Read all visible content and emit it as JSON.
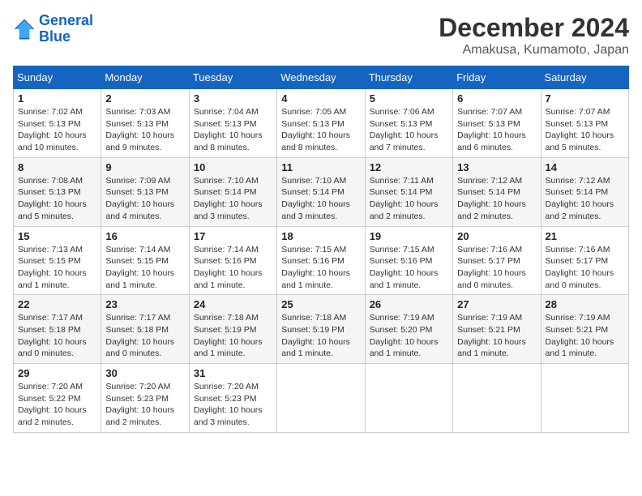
{
  "header": {
    "logo_line1": "General",
    "logo_line2": "Blue",
    "month": "December 2024",
    "location": "Amakusa, Kumamoto, Japan"
  },
  "weekdays": [
    "Sunday",
    "Monday",
    "Tuesday",
    "Wednesday",
    "Thursday",
    "Friday",
    "Saturday"
  ],
  "weeks": [
    [
      {
        "day": "1",
        "info": "Sunrise: 7:02 AM\nSunset: 5:13 PM\nDaylight: 10 hours\nand 10 minutes."
      },
      {
        "day": "2",
        "info": "Sunrise: 7:03 AM\nSunset: 5:13 PM\nDaylight: 10 hours\nand 9 minutes."
      },
      {
        "day": "3",
        "info": "Sunrise: 7:04 AM\nSunset: 5:13 PM\nDaylight: 10 hours\nand 8 minutes."
      },
      {
        "day": "4",
        "info": "Sunrise: 7:05 AM\nSunset: 5:13 PM\nDaylight: 10 hours\nand 8 minutes."
      },
      {
        "day": "5",
        "info": "Sunrise: 7:06 AM\nSunset: 5:13 PM\nDaylight: 10 hours\nand 7 minutes."
      },
      {
        "day": "6",
        "info": "Sunrise: 7:07 AM\nSunset: 5:13 PM\nDaylight: 10 hours\nand 6 minutes."
      },
      {
        "day": "7",
        "info": "Sunrise: 7:07 AM\nSunset: 5:13 PM\nDaylight: 10 hours\nand 5 minutes."
      }
    ],
    [
      {
        "day": "8",
        "info": "Sunrise: 7:08 AM\nSunset: 5:13 PM\nDaylight: 10 hours\nand 5 minutes."
      },
      {
        "day": "9",
        "info": "Sunrise: 7:09 AM\nSunset: 5:13 PM\nDaylight: 10 hours\nand 4 minutes."
      },
      {
        "day": "10",
        "info": "Sunrise: 7:10 AM\nSunset: 5:14 PM\nDaylight: 10 hours\nand 3 minutes."
      },
      {
        "day": "11",
        "info": "Sunrise: 7:10 AM\nSunset: 5:14 PM\nDaylight: 10 hours\nand 3 minutes."
      },
      {
        "day": "12",
        "info": "Sunrise: 7:11 AM\nSunset: 5:14 PM\nDaylight: 10 hours\nand 2 minutes."
      },
      {
        "day": "13",
        "info": "Sunrise: 7:12 AM\nSunset: 5:14 PM\nDaylight: 10 hours\nand 2 minutes."
      },
      {
        "day": "14",
        "info": "Sunrise: 7:12 AM\nSunset: 5:14 PM\nDaylight: 10 hours\nand 2 minutes."
      }
    ],
    [
      {
        "day": "15",
        "info": "Sunrise: 7:13 AM\nSunset: 5:15 PM\nDaylight: 10 hours\nand 1 minute."
      },
      {
        "day": "16",
        "info": "Sunrise: 7:14 AM\nSunset: 5:15 PM\nDaylight: 10 hours\nand 1 minute."
      },
      {
        "day": "17",
        "info": "Sunrise: 7:14 AM\nSunset: 5:16 PM\nDaylight: 10 hours\nand 1 minute."
      },
      {
        "day": "18",
        "info": "Sunrise: 7:15 AM\nSunset: 5:16 PM\nDaylight: 10 hours\nand 1 minute."
      },
      {
        "day": "19",
        "info": "Sunrise: 7:15 AM\nSunset: 5:16 PM\nDaylight: 10 hours\nand 1 minute."
      },
      {
        "day": "20",
        "info": "Sunrise: 7:16 AM\nSunset: 5:17 PM\nDaylight: 10 hours\nand 0 minutes."
      },
      {
        "day": "21",
        "info": "Sunrise: 7:16 AM\nSunset: 5:17 PM\nDaylight: 10 hours\nand 0 minutes."
      }
    ],
    [
      {
        "day": "22",
        "info": "Sunrise: 7:17 AM\nSunset: 5:18 PM\nDaylight: 10 hours\nand 0 minutes."
      },
      {
        "day": "23",
        "info": "Sunrise: 7:17 AM\nSunset: 5:18 PM\nDaylight: 10 hours\nand 0 minutes."
      },
      {
        "day": "24",
        "info": "Sunrise: 7:18 AM\nSunset: 5:19 PM\nDaylight: 10 hours\nand 1 minute."
      },
      {
        "day": "25",
        "info": "Sunrise: 7:18 AM\nSunset: 5:19 PM\nDaylight: 10 hours\nand 1 minute."
      },
      {
        "day": "26",
        "info": "Sunrise: 7:19 AM\nSunset: 5:20 PM\nDaylight: 10 hours\nand 1 minute."
      },
      {
        "day": "27",
        "info": "Sunrise: 7:19 AM\nSunset: 5:21 PM\nDaylight: 10 hours\nand 1 minute."
      },
      {
        "day": "28",
        "info": "Sunrise: 7:19 AM\nSunset: 5:21 PM\nDaylight: 10 hours\nand 1 minute."
      }
    ],
    [
      {
        "day": "29",
        "info": "Sunrise: 7:20 AM\nSunset: 5:22 PM\nDaylight: 10 hours\nand 2 minutes."
      },
      {
        "day": "30",
        "info": "Sunrise: 7:20 AM\nSunset: 5:23 PM\nDaylight: 10 hours\nand 2 minutes."
      },
      {
        "day": "31",
        "info": "Sunrise: 7:20 AM\nSunset: 5:23 PM\nDaylight: 10 hours\nand 3 minutes."
      },
      null,
      null,
      null,
      null
    ]
  ]
}
